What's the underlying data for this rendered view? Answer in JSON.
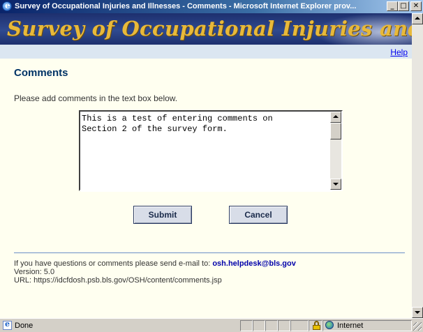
{
  "window": {
    "title": "Survey of Occupational Injuries and Illnesses - Comments - Microsoft Internet Explorer prov...",
    "minimize": "_",
    "maximize": "□",
    "close": "✕"
  },
  "banner": {
    "title": "Survey of Occupational Injuries and Illnesses"
  },
  "help_link": "Help",
  "page": {
    "heading": "Comments",
    "instructions": "Please add comments in the text box below.",
    "comment_text": "This is a test of entering comments on\nSection 2 of the survey form."
  },
  "buttons": {
    "submit": "Submit",
    "cancel": "Cancel"
  },
  "footer": {
    "contact_prefix": "If you have questions or comments please send e-mail to:",
    "email": "osh.helpdesk@bls.gov",
    "version": "Version: 5.0",
    "url": "URL: https://idcfdosh.psb.bls.gov/OSH/content/comments.jsp"
  },
  "statusbar": {
    "status": "Done",
    "zone": "Internet"
  },
  "icons": [
    "ie-icon",
    "lock-icon",
    "internet-zone-icon",
    "scroll-up-icon",
    "scroll-down-icon"
  ]
}
